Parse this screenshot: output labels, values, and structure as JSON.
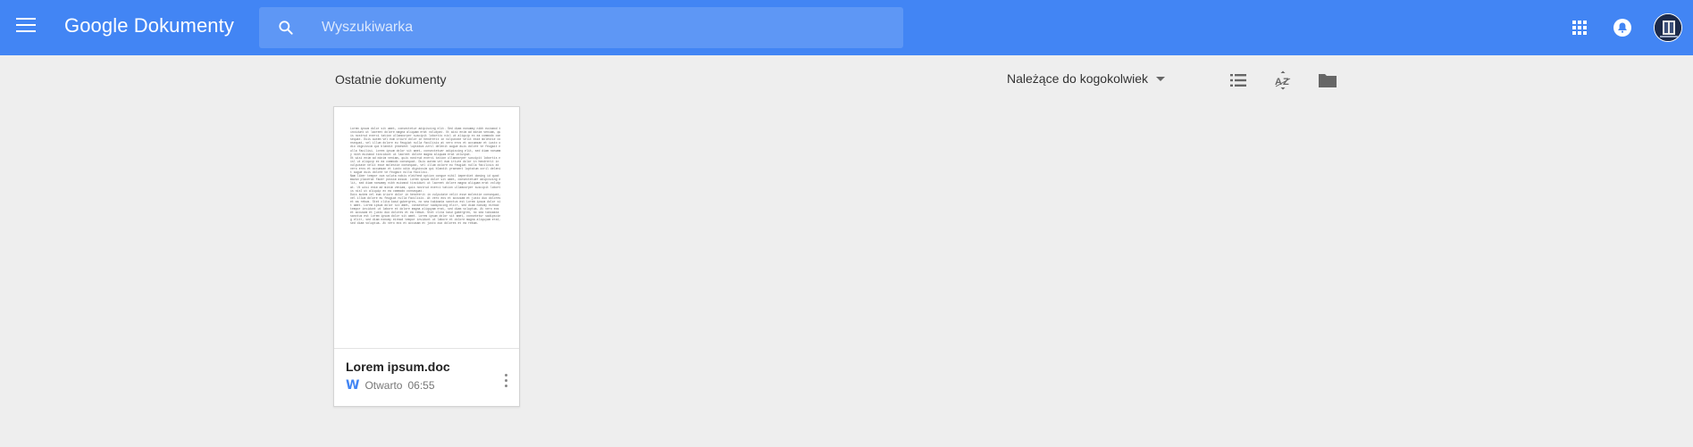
{
  "header": {
    "app_title": "Google Dokumenty",
    "search_placeholder": "Wyszukiwarka",
    "icons": [
      "menu-icon",
      "search-icon",
      "apps-grid-icon",
      "notifications-icon",
      "account-avatar"
    ],
    "background_color": "#4285f4"
  },
  "toolbar": {
    "section_title": "Ostatnie dokumenty",
    "owner_filter": "Należące do kogokolwiek",
    "icons": [
      "list-view-icon",
      "sort-az-icon",
      "folder-icon"
    ]
  },
  "documents": [
    {
      "name": "Lorem ipsum.doc",
      "type_icon": "W",
      "status": "Otwarto",
      "time": "06:55"
    }
  ]
}
